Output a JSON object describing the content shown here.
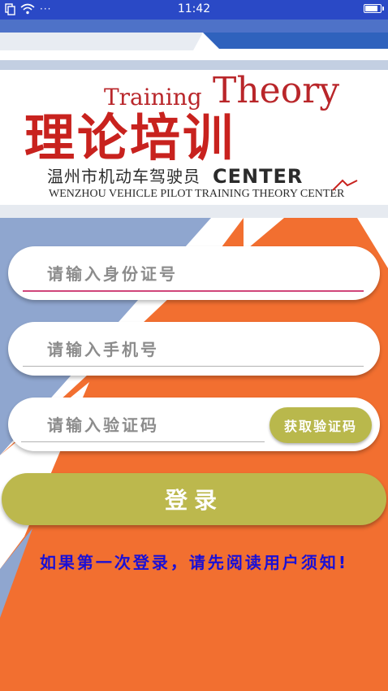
{
  "status_bar": {
    "time": "11:42",
    "dots": "···",
    "battery_level": 0.85
  },
  "logo": {
    "theory": "Theory",
    "training": "Training",
    "cn_title": "理论培训",
    "cn_subtitle": "温州市机动车驾驶员",
    "center": "CENTER",
    "en_subtitle": "WENZHOU VEHICLE PILOT TRAINING THEORY CENTER"
  },
  "form": {
    "id_placeholder": "请输入身份证号",
    "phone_placeholder": "请输入手机号",
    "code_placeholder": "请输入验证码",
    "get_code_label": "获取验证码",
    "login_label": "登录"
  },
  "notice": {
    "text": "如果第一次登录，请先阅读用户须知!"
  },
  "colors": {
    "status_bar": "#2a49c6",
    "brand_red": "#c8221e",
    "button_olive": "#bcb84d",
    "orange": "#f26f30",
    "steel_blue": "#8fa6cf",
    "notice_blue": "#1a10d6",
    "active_underline": "#d0457a"
  }
}
